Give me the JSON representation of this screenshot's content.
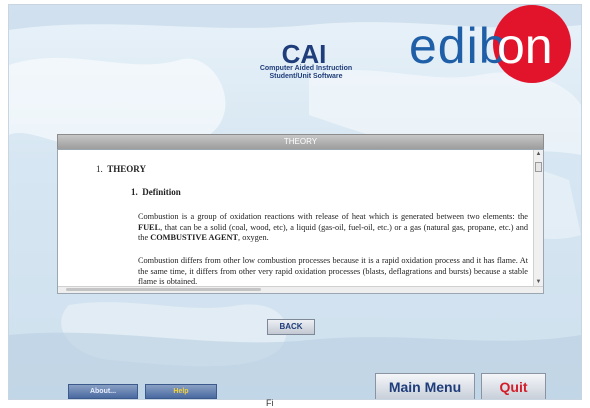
{
  "header": {
    "title": "CAI",
    "subtitle_line1": "Computer Aided Instruction",
    "subtitle_line2": "Student/Unit Software",
    "logo_prefix": "edib",
    "logo_suffix": "on"
  },
  "section_bar": {
    "label": "THEORY"
  },
  "document": {
    "heading_number": "1.",
    "heading": "THEORY",
    "subheading_number": "1.",
    "subheading": "Definition",
    "paragraph1_a": "Combustion is a group of oxidation reactions with release of heat which is generated between two elements: the ",
    "paragraph1_b": "FUEL",
    "paragraph1_c": ", that can be a solid (coal, wood, etc), a liquid (gas-oil, fuel-oil, etc.) or a gas (natural gas, propane, etc.) and the ",
    "paragraph1_d": "COMBUSTIVE AGENT",
    "paragraph1_e": ", oxygen.",
    "paragraph2": "Combustion differs from other low combustion processes because it is a rapid oxidation process and it has flame. At the same time, it differs from other very rapid oxidation processes (blasts, deflagrations and bursts) because a stable flame is obtained."
  },
  "buttons": {
    "back": "BACK",
    "about": "About...",
    "help": "Help",
    "main_menu": "Main Menu",
    "quit": "Quit"
  },
  "caption": "Fi",
  "colors": {
    "brand_blue": "#1f5fa8",
    "brand_red": "#e2142c",
    "quit_red": "#d31d2a",
    "help_yellow": "#f2d23a"
  },
  "icons": {
    "scroll_up": "scroll-up-arrow-icon",
    "scroll_down": "scroll-down-arrow-icon"
  }
}
